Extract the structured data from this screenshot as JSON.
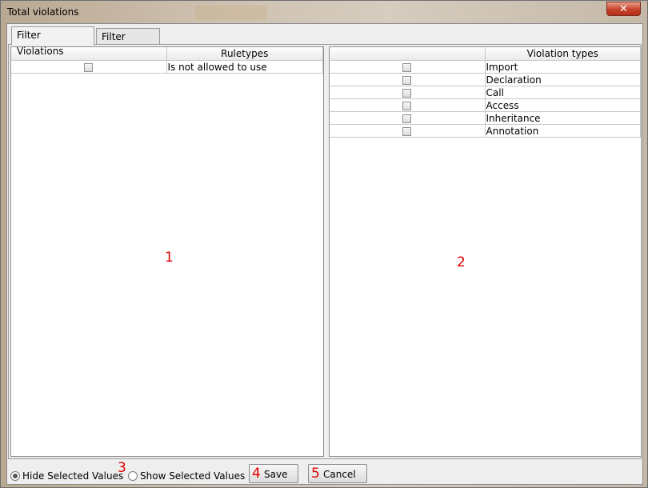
{
  "window": {
    "title": "Total violations",
    "close_label": "✕"
  },
  "tabs": [
    {
      "label": "Filter Violations",
      "active": true
    },
    {
      "label": "Filter Paths",
      "active": false
    }
  ],
  "left_table": {
    "headers": [
      "",
      "Ruletypes"
    ],
    "rows": [
      {
        "checked": false,
        "label": "Is not allowed to use"
      }
    ],
    "marker": "1"
  },
  "right_table": {
    "headers": [
      "",
      "Violation types"
    ],
    "rows": [
      {
        "checked": false,
        "label": "Import"
      },
      {
        "checked": false,
        "label": "Declaration"
      },
      {
        "checked": false,
        "label": "Call"
      },
      {
        "checked": false,
        "label": "Access"
      },
      {
        "checked": false,
        "label": "Inheritance"
      },
      {
        "checked": false,
        "label": "Annotation"
      }
    ],
    "marker": "2"
  },
  "footer": {
    "hide_label": "Hide Selected Values",
    "hide_selected": true,
    "marker_3": "3",
    "show_label": "Show Selected Values",
    "show_selected": false,
    "save_marker": "4",
    "save_label": "Save",
    "cancel_marker": "5",
    "cancel_label": "Cancel"
  },
  "colors": {
    "marker": "#e00000",
    "close": "#c7412a"
  }
}
